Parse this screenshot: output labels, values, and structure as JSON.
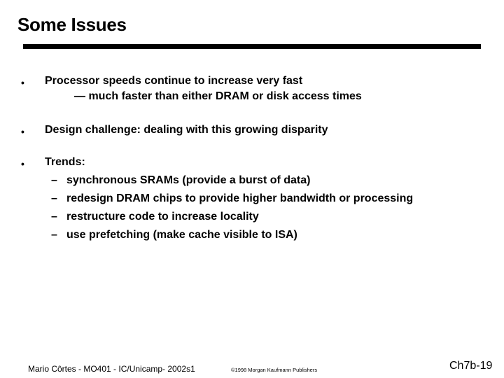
{
  "slide": {
    "title": "Some Issues",
    "bullets": [
      {
        "marker": "•",
        "text": "Processor speeds continue to increase very fast",
        "continuation": "— much faster than either DRAM or disk access times"
      },
      {
        "marker": "•",
        "text": "Design challenge:  dealing with this growing disparity"
      },
      {
        "marker": "•",
        "text": "Trends:",
        "subitems": [
          {
            "marker": "–",
            "text": "synchronous SRAMs (provide a burst of data)"
          },
          {
            "marker": "–",
            "text": "redesign DRAM chips to provide higher bandwidth or processing"
          },
          {
            "marker": "–",
            "text": "restructure code to increase locality"
          },
          {
            "marker": "–",
            "text": "use prefetching (make cache visible to ISA)"
          }
        ]
      }
    ]
  },
  "footer": {
    "author": "Mario Côrtes - MO401 - IC/Unicamp- 2002s1",
    "copyright": "©1998 Morgan Kaufmann Publishers",
    "slide_number": "Ch7b-19"
  }
}
